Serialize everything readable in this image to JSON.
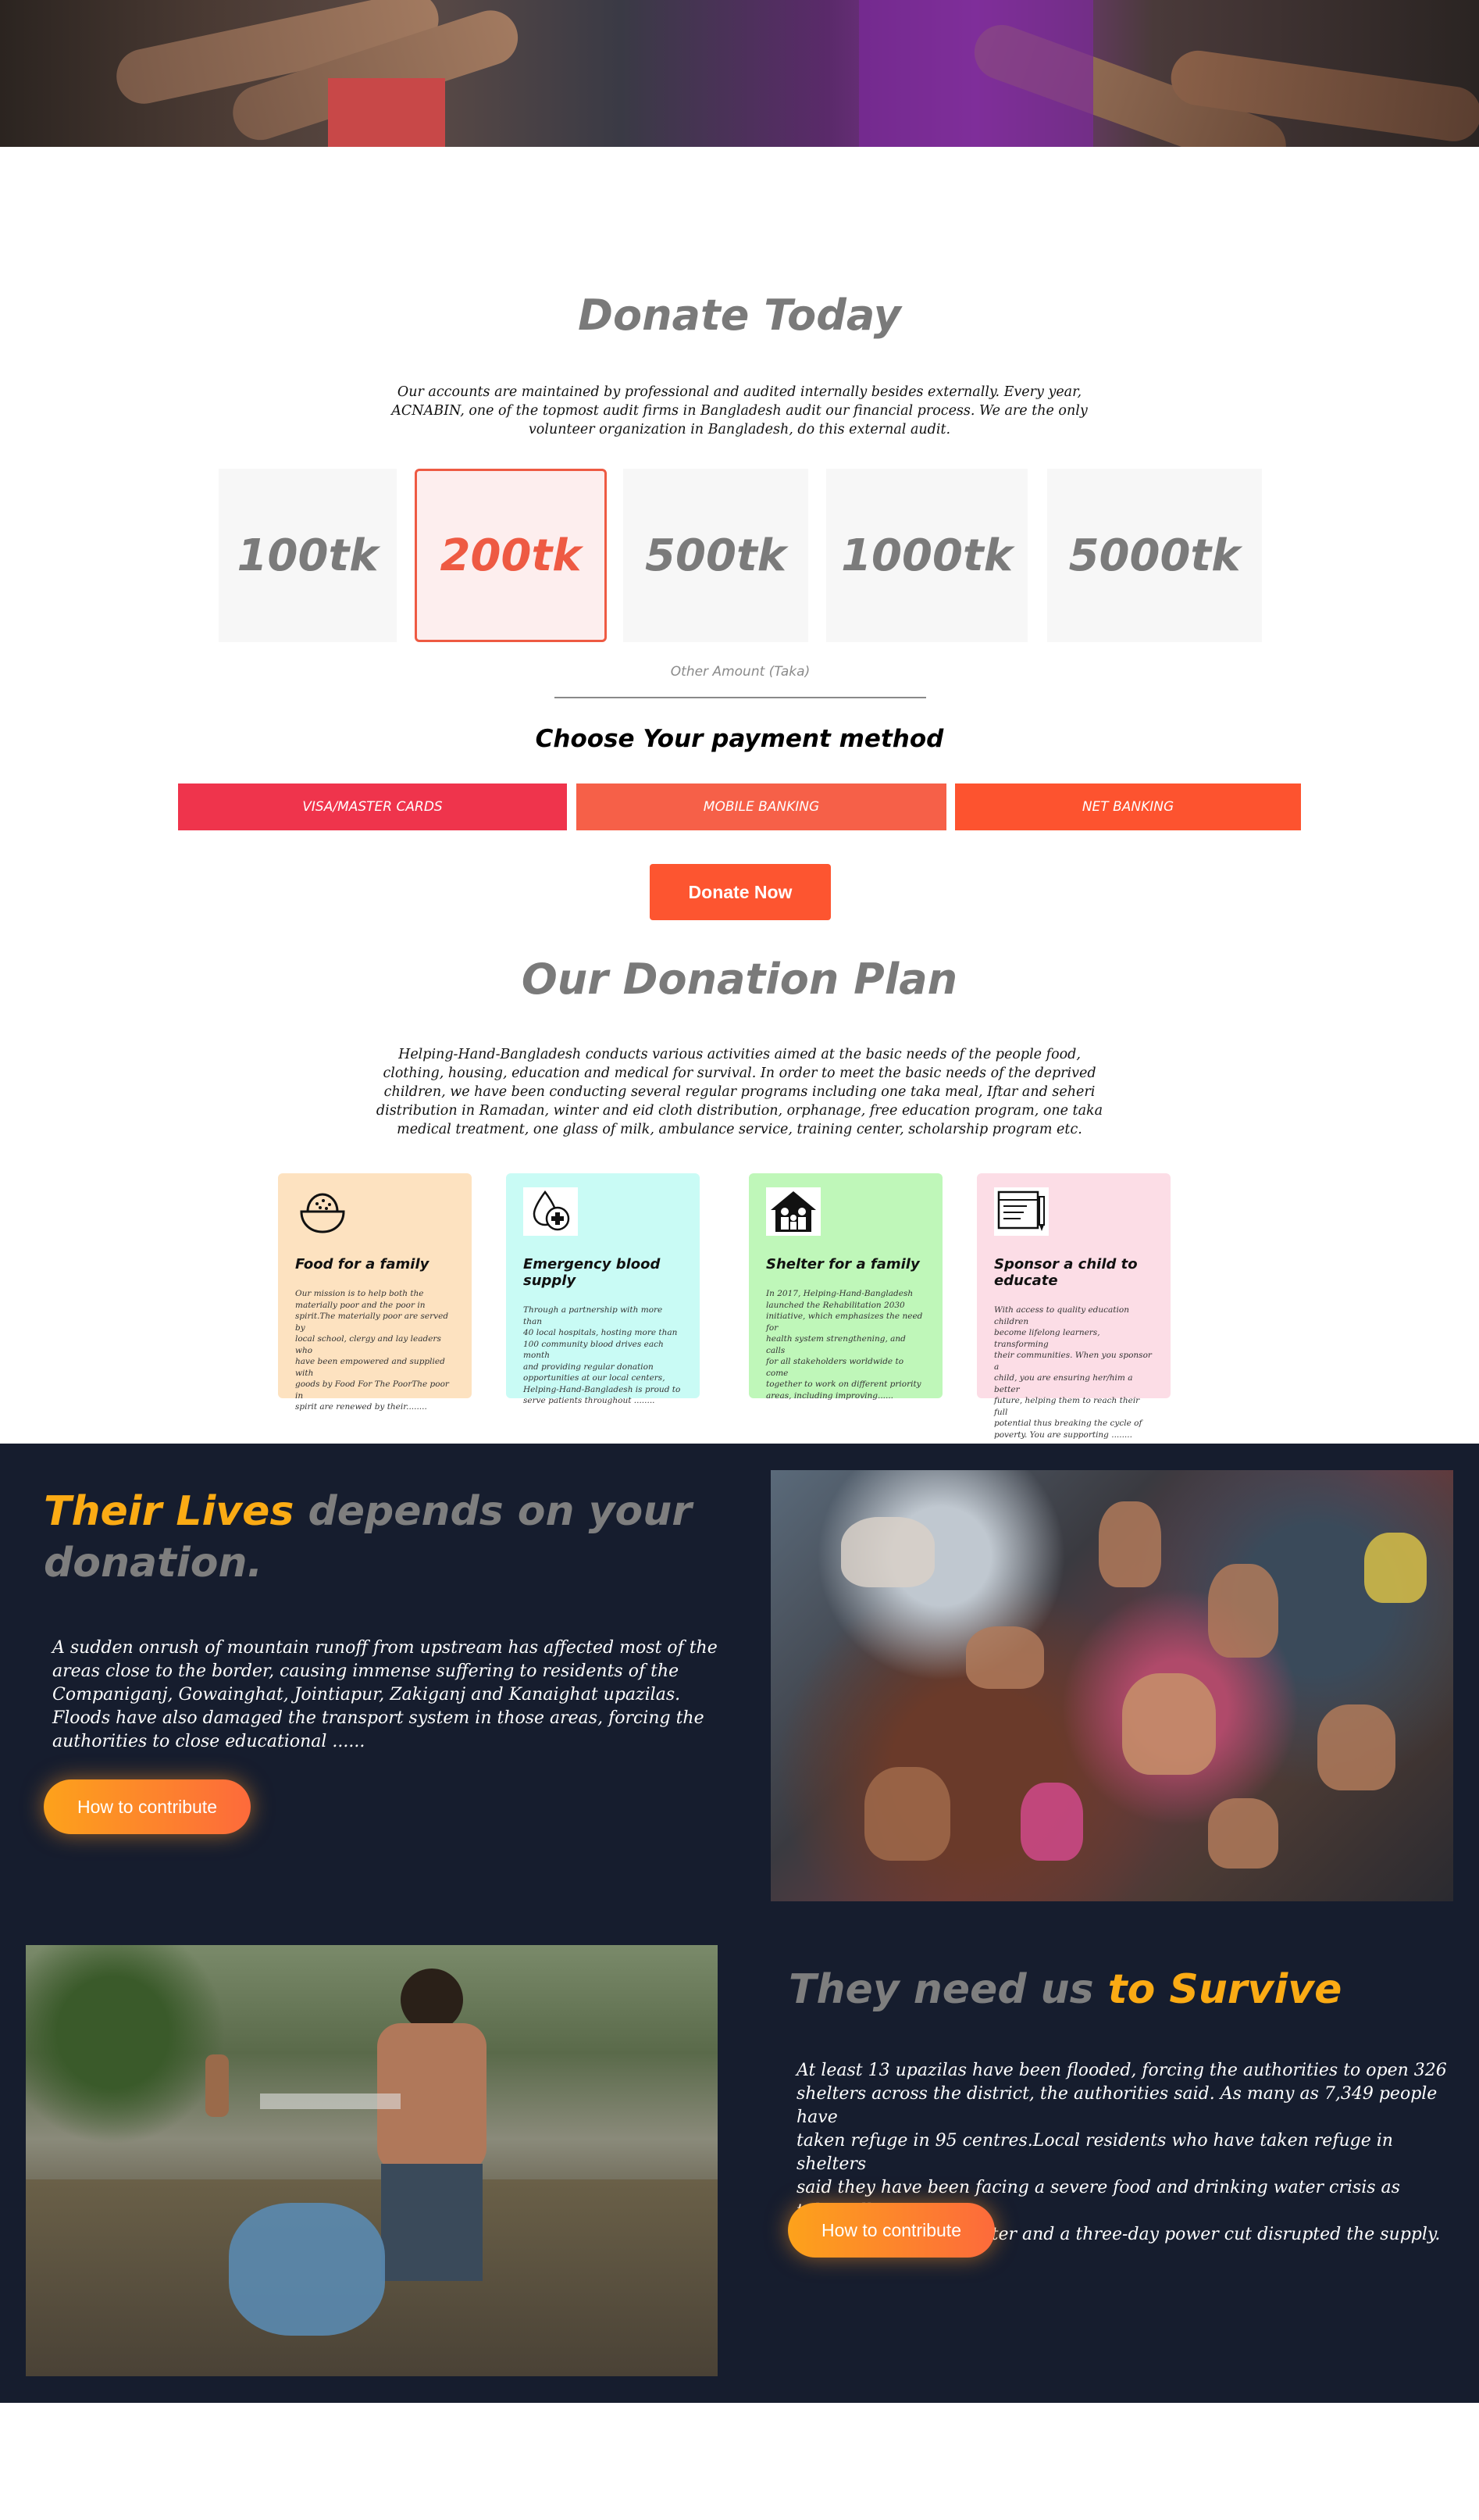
{
  "donate": {
    "title": "Donate Today",
    "intro_lines": [
      "Our accounts are maintained by professional and audited internally besides externally. Every year,",
      "ACNABIN, one of the topmost audit firms in Bangladesh audit our financial process. We are the only",
      "volunteer organization in Bangladesh, do this external audit."
    ],
    "amounts": [
      "100tk",
      "200tk",
      "500tk",
      "1000tk",
      "5000tk"
    ],
    "selected_amount": "200tk",
    "other_amount_placeholder": "Other Amount (Taka)",
    "payment_title": "Choose Your payment method",
    "payment_methods": [
      "VISA/MASTER CARDS",
      "MOBILE BANKING",
      "NET BANKING"
    ],
    "payment_colors": [
      "#ef344c",
      "#f66048",
      "#fd532f"
    ],
    "donate_button": "Donate Now"
  },
  "plan": {
    "title": "Our Donation Plan",
    "intro_lines": [
      "Helping-Hand-Bangladesh conducts various activities aimed at the basic needs of the people food,",
      "clothing, housing, education and medical for survival. In order to meet the basic needs of the deprived",
      "children, we have been conducting several regular programs including one taka meal, Iftar and seheri",
      "distribution in Ramadan, winter and eid cloth distribution, orphanage, free education program, one taka",
      "medical treatment, one glass of milk, ambulance service, training center, scholarship program etc."
    ],
    "cards": [
      {
        "title": "Food for a family",
        "icon": "food-bowl-icon",
        "color": "#fde2c0",
        "desc": [
          "Our mission is to help both the",
          "materially poor and the poor in",
          "spirit.The materially poor are served by",
          "local school, clergy and lay leaders who",
          "have been empowered and supplied with",
          "goods by Food For The PoorThe poor in",
          "spirit are renewed by their........"
        ]
      },
      {
        "title": "Emergency blood supply",
        "icon": "blood-drop-icon",
        "color": "#c9fbf5",
        "desc": [
          "Through a partnership with more than",
          "40 local hospitals, hosting more than",
          "100 community blood drives each month",
          "and providing regular donation",
          "opportunities at our local centers,",
          "Helping-Hand-Bangladesh is proud to",
          "serve patients throughout ........"
        ]
      },
      {
        "title": "Shelter for a family",
        "icon": "family-shelter-icon",
        "color": "#bff7b9",
        "desc": [
          "In 2017, Helping-Hand-Bangladesh",
          "launched the Rehabilitation 2030",
          "initiative, which emphasizes the need for",
          "health system strengthening, and calls",
          "for all stakeholders worldwide to come",
          "together to work on different priority",
          "areas, including improving......"
        ]
      },
      {
        "title": "Sponsor a child to educate",
        "icon": "education-board-icon",
        "color": "#fcdde6",
        "desc": [
          "With access to quality education children",
          "become lifelong learners, transforming",
          "their communities. When you sponsor a",
          "child, you are ensuring her/him a better",
          "future, helping them to reach their full",
          "potential thus breaking the cycle of",
          "poverty. You are supporting ........"
        ]
      }
    ]
  },
  "lives": {
    "title_highlight": "Their Lives",
    "title_rest_1": " depends on your",
    "title_rest_2": "donation.",
    "lines": [
      "A sudden onrush of mountain runoff from upstream has affected most of the",
      "areas close to the border, causing immense suffering to residents of the",
      "Companiganj, Gowainghat, Jointiapur, Zakiganj and Kanaighat upazilas.",
      "Floods have also damaged the transport system in those areas, forcing the",
      "authorities to close educational ......"
    ],
    "button": "How to contribute"
  },
  "survive": {
    "title_gray": "They need us ",
    "title_highlight": "to Survive",
    "lines": [
      "At least 13 upazilas have been flooded, forcing the authorities to open 326",
      "shelters across the district, the authorities said. As many as 7,349 people have",
      "taken refuge in 95 centres.Local residents who have taken refuge in shelters",
      "said they have been facing a severe food and drinking water crisis as tubewells",
      "were flooded underwater and a three-day power cut disrupted the supply."
    ],
    "button": "How to contribute"
  }
}
